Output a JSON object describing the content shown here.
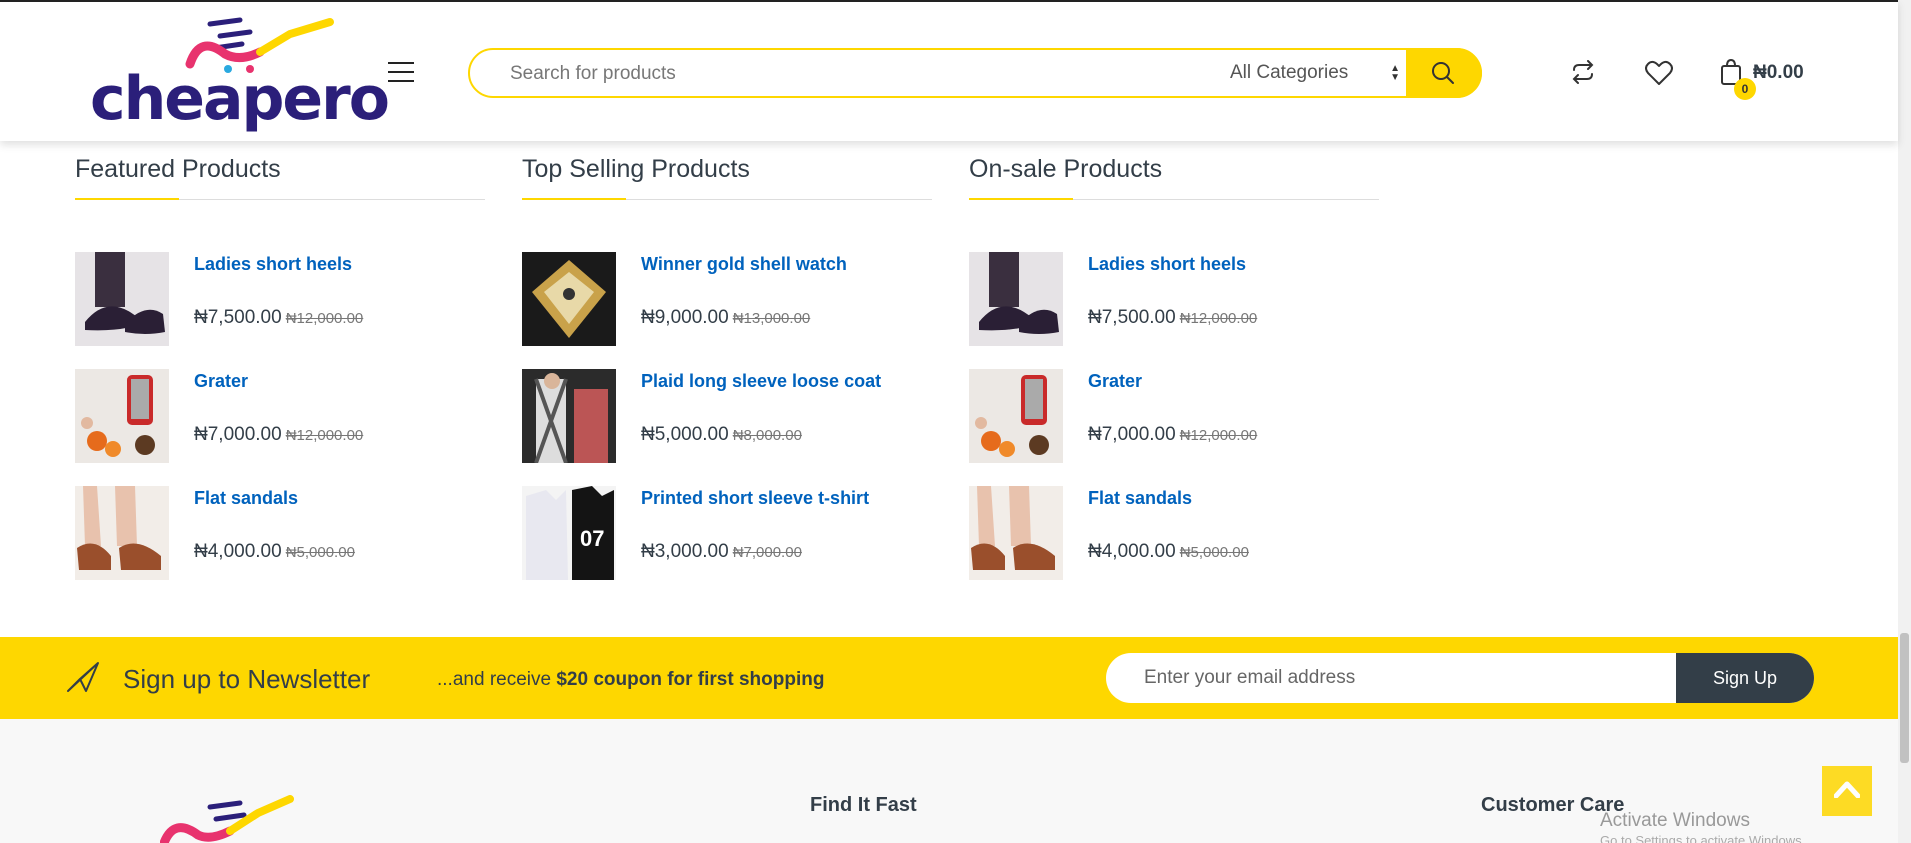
{
  "header": {
    "logo_text": "cheapero",
    "search": {
      "placeholder": "Search for products",
      "category": "All Categories"
    },
    "cart": {
      "count": "0",
      "total": "₦0.00"
    }
  },
  "columns": [
    {
      "title": "Featured Products",
      "items": [
        {
          "name": "Ladies short heels",
          "price": "₦7,500.00",
          "old_price": "₦12,000.00",
          "thumb": "heels"
        },
        {
          "name": "Grater",
          "price": "₦7,000.00",
          "old_price": "₦12,000.00",
          "thumb": "grater"
        },
        {
          "name": "Flat sandals",
          "price": "₦4,000.00",
          "old_price": "₦5,000.00",
          "thumb": "sandals"
        }
      ]
    },
    {
      "title": "Top Selling Products",
      "items": [
        {
          "name": "Winner gold shell watch",
          "price": "₦9,000.00",
          "old_price": "₦13,000.00",
          "thumb": "watch"
        },
        {
          "name": "Plaid long sleeve loose coat",
          "price": "₦5,000.00",
          "old_price": "₦8,000.00",
          "thumb": "coat"
        },
        {
          "name": "Printed short sleeve t-shirt",
          "price": "₦3,000.00",
          "old_price": "₦7,000.00",
          "thumb": "tshirt"
        }
      ]
    },
    {
      "title": "On-sale Products",
      "items": [
        {
          "name": "Ladies short heels",
          "price": "₦7,500.00",
          "old_price": "₦12,000.00",
          "thumb": "heels"
        },
        {
          "name": "Grater",
          "price": "₦7,000.00",
          "old_price": "₦12,000.00",
          "thumb": "grater"
        },
        {
          "name": "Flat sandals",
          "price": "₦4,000.00",
          "old_price": "₦5,000.00",
          "thumb": "sandals"
        }
      ]
    }
  ],
  "newsletter": {
    "title": "Sign up to Newsletter",
    "sub_prefix": "...and receive ",
    "sub_bold": "$20 coupon for first shopping",
    "email_placeholder": "Enter your email address",
    "button": "Sign Up"
  },
  "footer": {
    "find_it_fast": "Find It Fast",
    "customer_care": "Customer Care"
  },
  "os_overlay": {
    "activate": "Activate Windows",
    "activate_sub": "Go to Settings to activate Windows."
  },
  "colors": {
    "accent": "#fed700",
    "link": "#0062bd",
    "dark": "#333e48"
  },
  "icons": [
    "hamburger-icon",
    "search-icon",
    "compare-icon",
    "heart-icon",
    "shopping-bag-icon",
    "paper-plane-icon",
    "chevron-up-icon"
  ]
}
